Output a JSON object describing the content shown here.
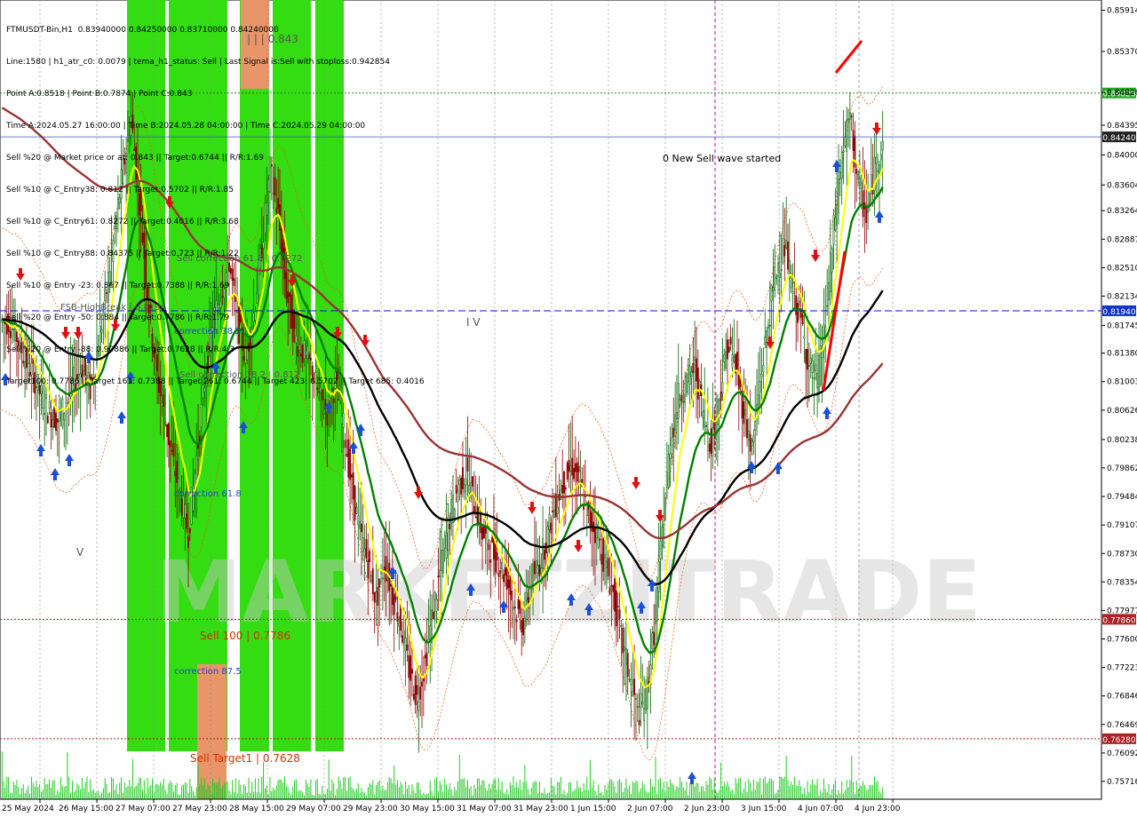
{
  "header": {
    "symbol_line": "FTMUSDT-Bin,H1  0.83940000 0.84250000 0.83710000 0.84240000",
    "lines": [
      "Line:1580 | h1_atr_c0: 0.0079 | tema_h1_status: Sell | Last Signal is:Sell with stoploss:0.942854",
      "Point A:0.8518 | Point B:0.7874 | Point C:0.843",
      "Time A:2024.05.27 16:00:00 | Time B:2024.05.28 04:00:00 | Time C:2024.05.29 04:00:00",
      "Sell %20 @ Market price or at: 0.843 || Target:0.6744 || R/R:1.69",
      "Sell %10 @ C_Entry38: 0.812 || Target:0.5702 || R/R:1.85",
      "Sell %10 @ C_Entry61: 0.8272 || Target:0.4016 || R/R:3.68",
      "Sell %10 @ C_Entry88: 0.84375 || Target:0.723 || R/R:1.22",
      "Sell %10 @ Entry -23: 0.867 || Target:0.7388 || R/R:1.69",
      "Sell %20 @ Entry -50: 0.884 || Target:0.7786 || R/R:1.79",
      "Sell %20 @ Entry -88: 0.90886 || Target:0.7628 || R/R:4.3",
      "Target100: 0.7786 || Target 161: 0.7388 || Target 261: 0.6744 || Target 423: 0.5702 || Target 685: 0.4016"
    ]
  },
  "annotations": {
    "lll": "| | | 0.843",
    "sell_correction_61": "Sell correction 61.8 | 0.8272",
    "fsb_highbreak": "FSB-HighBreak | 0.8194",
    "correction_38": "correction 38.2",
    "sell_correction_38": "Sell correction 38.2 | 0.812",
    "correction_61": "correction 61.8",
    "sell_100": "Sell 100 | 0.7786",
    "correction_87": "correction 87.5",
    "sell_target1": "Sell Target1 | 0.7628",
    "new_wave": "0 New Sell wave started",
    "iv": "I V",
    "v": "V",
    "watermark": "MARKETZITRADE"
  },
  "colors": {
    "bg": "#ffffff",
    "green_zone": "#33dd11",
    "orange_zone": "#e8956a",
    "bull": "#006400",
    "bear": "#8b0000",
    "ema_yellow": "#ffff00",
    "ema_green": "#008000",
    "ma_black": "#000000",
    "ma_brown": "#993333",
    "blue_line": "#2244aa",
    "green_dotted": "#228822",
    "red_dotted": "#aa2222",
    "arrow_up": "#1a4fd6",
    "arrow_down": "#e01010",
    "band": "#ff5500"
  },
  "chart_data": {
    "type": "candlestick",
    "symbol": "FTMUSDT-Bin",
    "timeframe": "H1",
    "ohlc_last": {
      "open": 0.8394,
      "high": 0.8425,
      "low": 0.8371,
      "close": 0.8424
    },
    "ylim": [
      0.7548,
      0.8605
    ],
    "y_ticks": [
      "0.85914",
      "0.85370",
      "0.84826",
      "0.84395",
      "0.84000",
      "0.83604",
      "0.83264",
      "0.82887",
      "0.82510",
      "0.82134",
      "0.81745",
      "0.81380",
      "0.81003",
      "0.80626",
      "0.80238",
      "0.79862",
      "0.79484",
      "0.79107",
      "0.78730",
      "0.78354",
      "0.77977",
      "0.77600",
      "0.77223",
      "0.76846",
      "0.76469",
      "0.76092",
      "0.75716"
    ],
    "x_labels": [
      "25 May 2024",
      "26 May 15:00",
      "27 May 07:00",
      "27 May 23:00",
      "28 May 15:00",
      "29 May 07:00",
      "29 May 23:00",
      "30 May 15:00",
      "31 May 07:00",
      "31 May 23:00",
      "1 Jun 15:00",
      "2 Jun 07:00",
      "2 Jun 23:00",
      "3 Jun 15:00",
      "4 Jun 07:00",
      "4 Jun 23:00"
    ],
    "levels": [
      {
        "name": "current_price",
        "value": 0.8424,
        "label": "0.84240",
        "style": "solid-blue"
      },
      {
        "name": "green_dotted",
        "value": 0.8482,
        "label": "0.84820",
        "style": "dotted-green"
      },
      {
        "name": "fsb_highbreak",
        "value": 0.8194,
        "label": "0.81940",
        "style": "dashed-blue"
      },
      {
        "name": "sell_100",
        "value": 0.7786,
        "label": "0.77860",
        "style": "dotted-red"
      },
      {
        "name": "sell_target1",
        "value": 0.7628,
        "label": "0.76280",
        "style": "dotted-red"
      }
    ],
    "close_path": [
      0.818,
      0.816,
      0.813,
      0.811,
      0.808,
      0.806,
      0.805,
      0.807,
      0.81,
      0.812,
      0.809,
      0.815,
      0.822,
      0.83,
      0.838,
      0.845,
      0.834,
      0.822,
      0.812,
      0.806,
      0.8,
      0.795,
      0.79,
      0.8,
      0.81,
      0.818,
      0.822,
      0.826,
      0.818,
      0.813,
      0.819,
      0.828,
      0.838,
      0.832,
      0.822,
      0.816,
      0.814,
      0.812,
      0.808,
      0.806,
      0.81,
      0.804,
      0.796,
      0.79,
      0.786,
      0.781,
      0.786,
      0.782,
      0.778,
      0.772,
      0.768,
      0.773,
      0.78,
      0.786,
      0.792,
      0.796,
      0.798,
      0.794,
      0.79,
      0.788,
      0.786,
      0.784,
      0.78,
      0.778,
      0.784,
      0.786,
      0.79,
      0.794,
      0.797,
      0.799,
      0.796,
      0.792,
      0.79,
      0.786,
      0.782,
      0.776,
      0.771,
      0.766,
      0.768,
      0.777,
      0.79,
      0.802,
      0.808,
      0.81,
      0.812,
      0.806,
      0.802,
      0.808,
      0.815,
      0.812,
      0.806,
      0.801,
      0.81,
      0.818,
      0.825,
      0.828,
      0.822,
      0.818,
      0.812,
      0.81,
      0.818,
      0.83,
      0.84,
      0.845,
      0.836,
      0.832,
      0.838,
      0.842
    ]
  }
}
